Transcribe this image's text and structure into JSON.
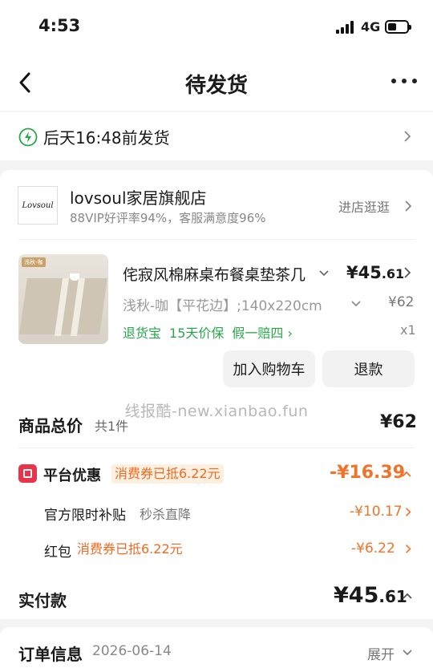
{
  "status_bar": {
    "time": "4:53",
    "network": "4G"
  },
  "nav": {
    "title": "待发货"
  },
  "shipping": {
    "text": "后天16:48前发货"
  },
  "shop": {
    "logo_text": "Lovsoul",
    "name": "lovsoul家居旗舰店",
    "stats": "88VIP好评率94%，客服满意度96%",
    "visit_label": "进店逛逛"
  },
  "product": {
    "thumb_tag": "浅秋-咖",
    "title": "侘寂风棉麻桌布餐桌垫茶几",
    "price_int": "¥45",
    "price_dec": ".61",
    "variant": "浅秋-咖【平花边】;140x220cm",
    "original_price": "¥62",
    "services": [
      "退货宝",
      "15天价保",
      "假一赔四 ›"
    ],
    "quantity": "x1",
    "add_cart_label": "加入购物车",
    "refund_label": "退款"
  },
  "watermark": "线报酷-new.xianbao.fun",
  "totals": {
    "label": "商品总价",
    "count": "共1件",
    "value": "¥62"
  },
  "discount": {
    "label": "平台优惠",
    "pill": "消费券已抵6.22元",
    "total": "-¥16.39",
    "items": [
      {
        "label": "官方限时补贴",
        "note": "秒杀直降",
        "value": "-¥10.17"
      },
      {
        "label": "红包",
        "pill": "消费券已抵6.22元",
        "value": "-¥6.22"
      }
    ]
  },
  "paid": {
    "label": "实付款",
    "int": "¥45",
    "dec": ".61"
  },
  "order_info": {
    "label": "订单信息",
    "date": "2026-06-14",
    "expand_label": "展开"
  },
  "colors": {
    "accent_orange": "#f07329",
    "service_green": "#2aa64a",
    "badge_red": "#e8344a"
  }
}
